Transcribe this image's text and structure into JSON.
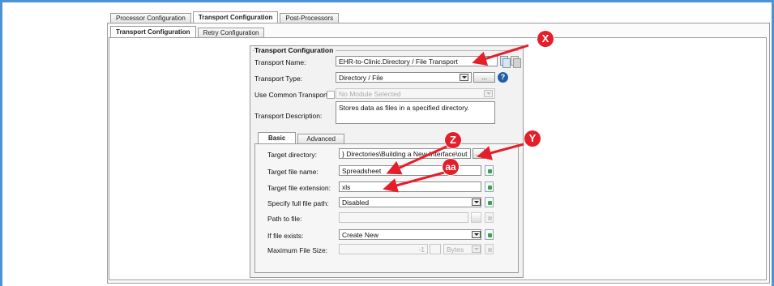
{
  "top_tabs": [
    "Processor Configuration",
    "Transport Configuration",
    "Post-Processors"
  ],
  "sub_tabs": [
    "Transport Configuration",
    "Retry Configuration"
  ],
  "transport": {
    "group_title": "Transport Configuration",
    "name_label": "Transport Name:",
    "name_value": "EHR-to-Clinic.Directory / File Transport",
    "type_label": "Transport Type:",
    "type_value": "Directory / File",
    "type_button": "...",
    "common_label": "Use Common Transport",
    "common_value": "No Module Selected",
    "desc_label": "Transport Description:",
    "desc_value": "Stores data as files in a specified directory."
  },
  "inner_tabs": [
    "Basic",
    "Advanced"
  ],
  "basic": {
    "target_dir_label": "Target directory:",
    "target_dir_value": "} Directories\\Building a New Interface\\out",
    "target_dir_button": "...",
    "file_name_label": "Target file name:",
    "file_name_value": "Spreadsheet",
    "file_ext_label": "Target file extension:",
    "file_ext_value": "xls",
    "full_path_label": "Specify full file path:",
    "full_path_value": "Disabled",
    "path_label": "Path to file:",
    "path_value": "",
    "exists_label": "If file exists:",
    "exists_value": "Create New",
    "max_size_label": "Maximum File Size:",
    "max_size_value": "-1",
    "max_size_unit": "Bytes"
  },
  "callouts": [
    "X",
    "Y",
    "Z",
    "aa"
  ],
  "colors": {
    "callout": "#e51f2a",
    "frame": "#4a94d6",
    "help": "#1f5fa8"
  }
}
